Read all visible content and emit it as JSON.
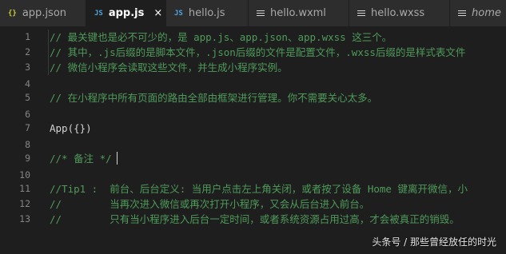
{
  "tabs": [
    {
      "label": "app.json",
      "icon": "json-braces-icon",
      "icon_text": "{}",
      "icon_color": "#cbcb41",
      "active": false
    },
    {
      "label": "app.js",
      "icon": "js-file-icon",
      "icon_text": "JS",
      "icon_color": "#4fa3e3",
      "active": true,
      "close": "×"
    },
    {
      "label": "hello.js",
      "icon": "js-file-icon",
      "icon_text": "JS",
      "icon_color": "#4fa3e3",
      "active": false
    },
    {
      "label": "hello.wxml",
      "icon": "lines-file-icon",
      "active": false
    },
    {
      "label": "hello.wxss",
      "icon": "lines-file-icon",
      "active": false
    },
    {
      "label": "home",
      "icon": "lines-file-icon",
      "active": false,
      "italic": true
    }
  ],
  "code_lines": [
    {
      "num": "1",
      "text": "// 最关键也是必不可少的，是 app.js、app.json、app.wxss 这三个。",
      "type": "comment"
    },
    {
      "num": "2",
      "text": "// 其中，.js后缀的是脚本文件，.json后缀的文件是配置文件，.wxss后缀的是样式表文件",
      "type": "comment"
    },
    {
      "num": "3",
      "text": "// 微信小程序会读取这些文件，并生成小程序实例。",
      "type": "comment"
    },
    {
      "num": "4",
      "text": "",
      "type": "plain"
    },
    {
      "num": "5",
      "text": "// 在小程序中所有页面的路由全部由框架进行管理。你不需要关心太多。",
      "type": "comment"
    },
    {
      "num": "6",
      "text": "",
      "type": "plain"
    },
    {
      "num": "7",
      "text": "App({})",
      "type": "plain"
    },
    {
      "num": "8",
      "text": "",
      "type": "plain"
    },
    {
      "num": "9",
      "text": "//* 备注 */",
      "type": "comment"
    },
    {
      "num": "10",
      "text": "",
      "type": "plain"
    },
    {
      "num": "11",
      "text": "//Tip1 :  前台、后台定义: 当用户点击左上角关闭，或者按了设备 Home 键离开微信，小",
      "type": "comment"
    },
    {
      "num": "12",
      "text": "//        当再次进入微信或再次打开小程序，又会从后台进入前台。",
      "type": "comment"
    },
    {
      "num": "13",
      "text": "//        只有当小程序进入后台一定时间，或者系统资源占用过高，才会被真正的销毁。",
      "type": "comment"
    }
  ],
  "watermark": "头条号 / 那些曾经放任的时光",
  "colors": {
    "background": "#1e1e1e",
    "tab_bar": "#252526",
    "comment": "#4f9b5a",
    "line_number": "#858585",
    "plain_text": "#d4d4d4"
  }
}
